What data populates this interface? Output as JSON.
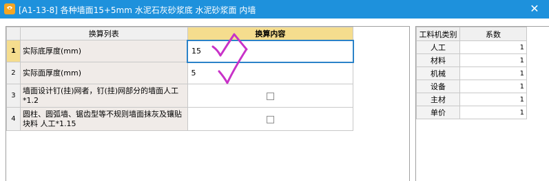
{
  "window": {
    "title": "[A1-13-8] 各种墙面15+5mm 水泥石灰砂浆底 水泥砂浆面 内墙",
    "close_label": "✕"
  },
  "conversion_grid": {
    "headers": {
      "list": "换算列表",
      "content": "换算内容"
    },
    "rows": [
      {
        "num": "1",
        "name": "实际底厚度(mm)",
        "value": "15"
      },
      {
        "num": "2",
        "name": "实际面厚度(mm)",
        "value": "5"
      },
      {
        "num": "3",
        "name": "墙面设计钉(挂)网者，钉(挂)网部分的墙面人工*1.2",
        "value": ""
      },
      {
        "num": "4",
        "name": "圆柱、圆弧墙、锯齿型等不规则墙面抹灰及镶贴块料 人工*1.15",
        "value": ""
      }
    ]
  },
  "coefficient_grid": {
    "headers": {
      "category": "工料机类别",
      "coef": "系数"
    },
    "rows": [
      {
        "category": "人工",
        "coef": "1"
      },
      {
        "category": "材料",
        "coef": "1"
      },
      {
        "category": "机械",
        "coef": "1"
      },
      {
        "category": "设备",
        "coef": "1"
      },
      {
        "category": "主材",
        "coef": "1"
      },
      {
        "category": "单价",
        "coef": "1"
      }
    ]
  },
  "colors": {
    "titlebar": "#1e91dc",
    "header_highlight": "#f5dd8e",
    "checkmark": "#c832c8",
    "active_border": "#2a82c8"
  }
}
